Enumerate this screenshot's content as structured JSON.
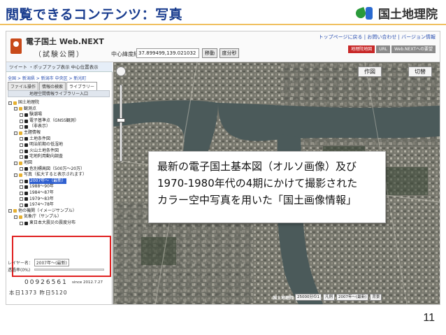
{
  "slide": {
    "title": "閲覧できるコンテンツ：写真",
    "org_name": "国土地理院",
    "page_number": "11"
  },
  "webnext": {
    "title": "電子国土 Web.NEXT",
    "subtitle": "（試験公開）",
    "coord_label": "中心緯度経度：",
    "coord_value": "37.899499,139.021032",
    "move_button": "移動",
    "degree_button": "度分秒",
    "top_links": "トップページに戻る | お問い合わせ | バージョン情報",
    "nav_buttons": [
      "地理院地図",
      "URL",
      "Web.NEXTへの要望"
    ],
    "toolbar_text": "ツイート ・ポップアップ表示 中心位置表示",
    "breadcrumb": "全国 > 新潟県 > 新潟市 中央区 > 新光町",
    "tabs": [
      "ファイル操作",
      "情報の検索",
      "ライブラリー"
    ],
    "library_header": "地理空間情報ライブラリー入口",
    "tree": [
      {
        "label": "国土地理院",
        "type": "folder",
        "level": 0
      },
      {
        "label": "観測点",
        "type": "folder",
        "level": 1
      },
      {
        "label": "験潮場",
        "type": "item",
        "level": 2
      },
      {
        "label": "電子基準点（GNSS観測）",
        "type": "item",
        "level": 2
      },
      {
        "label": "（非表示）",
        "type": "item",
        "level": 2
      },
      {
        "label": "主題情報",
        "type": "folder",
        "level": 1
      },
      {
        "label": "土地条件図",
        "type": "item",
        "level": 2
      },
      {
        "label": "明治前期の低湿地",
        "type": "item",
        "level": 2
      },
      {
        "label": "火山土地条件図",
        "type": "item",
        "level": 2
      },
      {
        "label": "宅地利用動向調査",
        "type": "item",
        "level": 2
      },
      {
        "label": "地図",
        "type": "folder",
        "level": 1
      },
      {
        "label": "色別標高図（500万～20万）",
        "type": "item",
        "level": 2
      },
      {
        "label": "写真（拡大すると表示されます）",
        "type": "folder",
        "level": 1
      },
      {
        "label": "2007年～（最新）",
        "type": "item",
        "level": 2,
        "highlight": true
      },
      {
        "label": "1988～90年",
        "type": "item",
        "level": 2
      },
      {
        "label": "1984～87年",
        "type": "item",
        "level": 2
      },
      {
        "label": "1979～83年",
        "type": "item",
        "level": 2
      },
      {
        "label": "1974～78年",
        "type": "item",
        "level": 2
      },
      {
        "label": "他の機関（イメージサンプル）",
        "type": "folder",
        "level": 0
      },
      {
        "label": "気象庁（サンプル）",
        "type": "folder",
        "level": 1
      },
      {
        "label": "東日本大震災の震度分布",
        "type": "item",
        "level": 2
      }
    ],
    "layer_label": "レイヤー名：",
    "layer_value": "2007年～(最新)",
    "transparency_label": "透過率(0%)",
    "counter_total": "00926561",
    "counter_since": "since 2012.7.27",
    "counter_today": "本日1373 昨日5120",
    "map_buttons": [
      "作図",
      "切替"
    ],
    "map_footer": [
      "国土地理院",
      "25000分の1",
      "凡例",
      "2007年～(最新)",
      "背景"
    ]
  },
  "callout": {
    "lines": [
      "最新の電子国土基本図（オルソ画像）及び",
      "1970-1980年代の4期にかけて撮影された",
      "カラー空中写真を用いた「国土画像情報」"
    ]
  },
  "colors": {
    "title": "#1a3d8f",
    "highlight_box": "#e02020",
    "river": "#4b5a5a",
    "nav_red": "#c82828"
  }
}
